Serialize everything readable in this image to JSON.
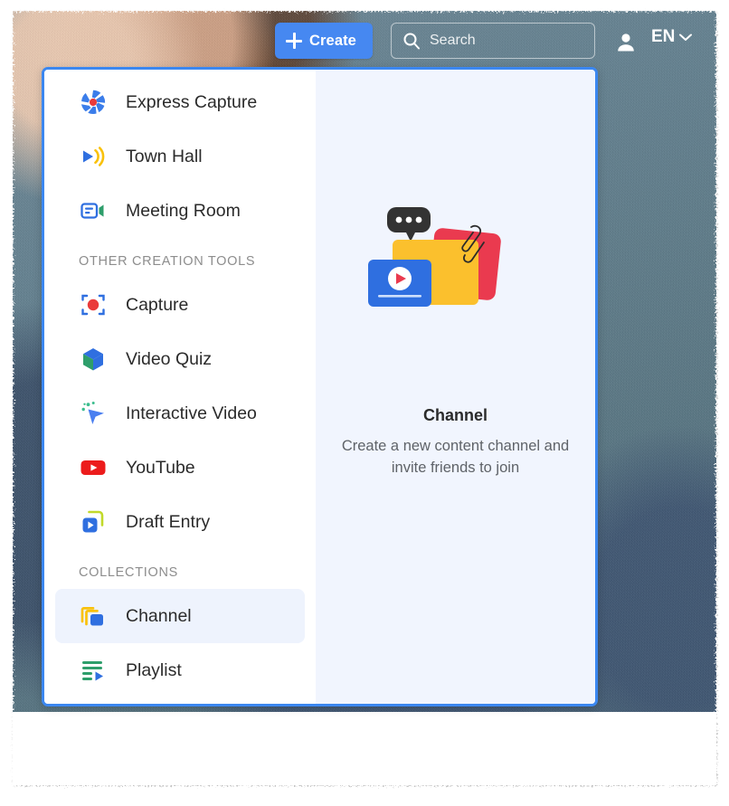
{
  "topbar": {
    "create_button": "Create",
    "create_icon": "plus-icon",
    "search_placeholder": "Search",
    "search_value": "",
    "search_icon": "search-icon",
    "user_icon": "user-avatar-icon",
    "language": "EN",
    "language_caret": "chevron-down-icon"
  },
  "menu": {
    "groups": [
      {
        "heading": null,
        "items": [
          {
            "label": "Express Capture",
            "icon": "aperture-icon",
            "selected": false
          },
          {
            "label": "Town Hall",
            "icon": "broadcast-icon",
            "selected": false
          },
          {
            "label": "Meeting Room",
            "icon": "video-chat-icon",
            "selected": false
          }
        ]
      },
      {
        "heading": "OTHER CREATION TOOLS",
        "items": [
          {
            "label": "Capture",
            "icon": "record-frame-icon",
            "selected": false
          },
          {
            "label": "Video Quiz",
            "icon": "cube-icon",
            "selected": false
          },
          {
            "label": "Interactive Video",
            "icon": "cursor-sparkle-icon",
            "selected": false
          },
          {
            "label": "YouTube",
            "icon": "youtube-icon",
            "selected": false
          },
          {
            "label": "Draft Entry",
            "icon": "draft-play-icon",
            "selected": false
          }
        ]
      },
      {
        "heading": "COLLECTIONS",
        "items": [
          {
            "label": "Channel",
            "icon": "channel-stack-icon",
            "selected": true
          },
          {
            "label": "Playlist",
            "icon": "playlist-icon",
            "selected": false
          }
        ]
      }
    ]
  },
  "preview": {
    "illustration": "channel-cards-illustration",
    "title": "Channel",
    "description": "Create a new content channel and invite friends to join"
  },
  "colors": {
    "accent_blue": "#3b87f0",
    "create_blue": "#4688f1",
    "highlight_row": "#eef3fd",
    "preview_bg": "#f1f5fe",
    "yellow": "#fbc02d",
    "red": "#ea3a4f",
    "green": "#2e9e6b",
    "youtube_red": "#ec1c1c"
  }
}
